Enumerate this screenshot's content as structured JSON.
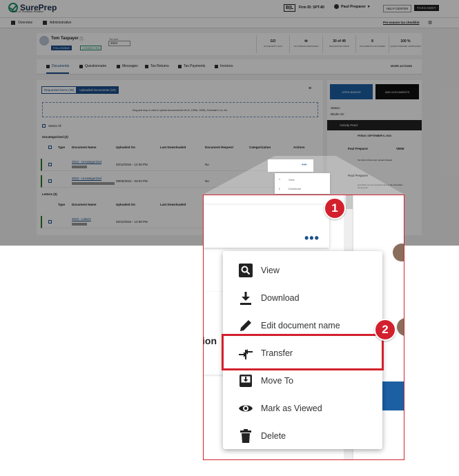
{
  "app": {
    "logo": "SurePrep",
    "logo_tagline": "Part of Thomson Reuters",
    "bl_badge": "B|L",
    "firm_id": "Firm ID: SPT-80",
    "user_name": "Paul Preparer",
    "help_center": "HELP CENTER",
    "tax_product": "TAXCADDY",
    "subnav": {
      "overview": "Overview",
      "administrative": "Administrative",
      "checklist": "Pre-season tax checklist"
    }
  },
  "client": {
    "name": "Tom Taxpayer",
    "following": "FOLLOWING",
    "connected": "CONNECTED",
    "tax_year_label": "Tax year",
    "tax_year": "2023",
    "stats": [
      {
        "value": "GO",
        "label": "NO RECENT LOGS"
      },
      {
        "value": "",
        "label": "NO UNREAD MESSAGES"
      },
      {
        "value": "30 of 49",
        "label": "REQUESTED ITEMS"
      },
      {
        "value": "8",
        "label": "DOCUMENTS UPLOADED"
      },
      {
        "value": "100 %",
        "label": "QUESTIONNAIRE COMPLETED"
      }
    ]
  },
  "tabs": [
    {
      "label": "Documents"
    },
    {
      "label": "Questionnaire"
    },
    {
      "label": "Messages"
    },
    {
      "label": "Tax Returns"
    },
    {
      "label": "Tax Payments"
    },
    {
      "label": "Invoices"
    }
  ],
  "more_actions": "MORE ACTIONS",
  "docs": {
    "segments": [
      "Requested Items (45)",
      "Uploaded Documents (10)"
    ],
    "dropzone": "Drag and drop or click to upload documents like W-2s, 1099s, 1098s, Schedule K-1s, etc.",
    "select_all": "Select All",
    "group_uncategorized": "Uncategorized (2)",
    "group_letters": "Letters (3)",
    "columns": [
      "Type",
      "Document Name",
      "Uploaded On",
      "Last Downloaded",
      "Document Request",
      "Categorization",
      "Actions"
    ],
    "rows": [
      {
        "name": "2023 - Uncategorized",
        "uploaded": "02/12/2024 - 12:29 PM",
        "request": "No"
      },
      {
        "name": "2023 - Uncategorized",
        "uploaded": "09/05/2024 - 03:04 PM",
        "request": "No"
      },
      {
        "name": "2023 - Letters",
        "uploaded": "02/12/2024 - 12:09 PM",
        "request": "No"
      }
    ]
  },
  "side": {
    "open_binder": "OPEN BINDER",
    "add_documents": "ADD DOCUMENTS",
    "status_label": "Status:",
    "binder_label": "Binder ID:",
    "activity_feed": "Activity Feed",
    "feed_date": "FRIDAY, SEPTEMBER 6, 2024",
    "feed_user": "Paul Preparer",
    "feed_view": "VIEW",
    "feed_text1": "Tax Return Document upload initiated.",
    "feed_text2": "Has filled your tax questionnaire or tax submitted documents."
  },
  "mini_menu": [
    "View",
    "Download"
  ],
  "menu": {
    "items": [
      {
        "label": "View",
        "icon": "search-icon"
      },
      {
        "label": "Download",
        "icon": "download-icon"
      },
      {
        "label": "Edit document name",
        "icon": "pencil-icon"
      },
      {
        "label": "Transfer",
        "icon": "transfer-icon"
      },
      {
        "label": "Move To",
        "icon": "move-to-icon"
      },
      {
        "label": "Mark as Viewed",
        "icon": "eye-icon"
      },
      {
        "label": "Delete",
        "icon": "trash-icon"
      }
    ]
  },
  "callouts": {
    "step1": "1",
    "step2": "2"
  },
  "zoom_fragment": "ion",
  "colors": {
    "accent": "#1c4f8c",
    "callout": "#d3202d",
    "connected": "#1a8f6a"
  }
}
